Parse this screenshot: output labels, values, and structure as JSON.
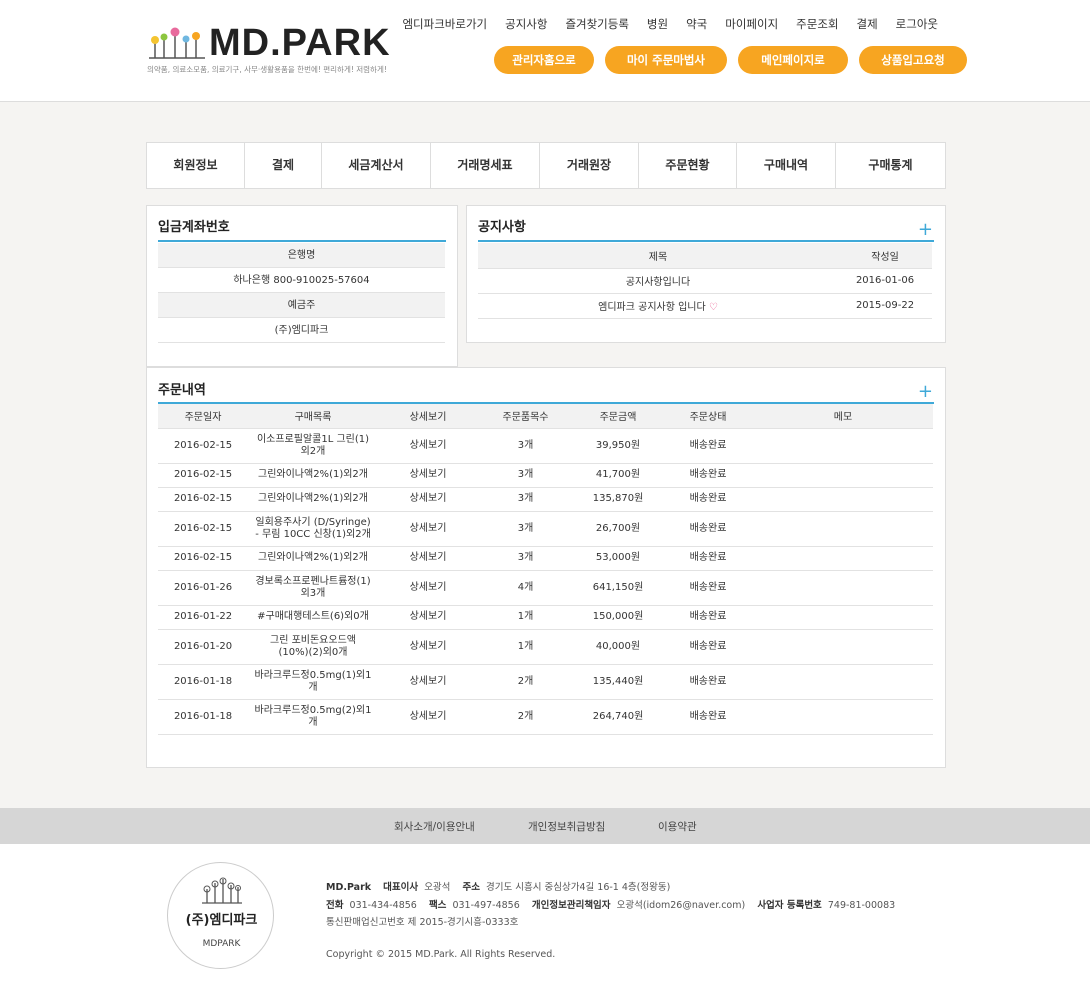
{
  "logo": {
    "text": "MD.PARK",
    "tagline": "의약품, 의료소모품, 의료기구, 사무·생활용품을 한번에! 편리하게! 저렴하게!"
  },
  "top_nav": [
    "엠디파크바로가기",
    "공지사항",
    "즐겨찾기등록",
    "병원",
    "약국",
    "마이페이지",
    "주문조회",
    "결제",
    "로그아웃"
  ],
  "orange_buttons": [
    "관리자홈으로",
    "마이 주문마법사",
    "메인페이지로",
    "상품입고요청"
  ],
  "tabs": [
    "회원정보",
    "결제",
    "세금계산서",
    "거래명세표",
    "거래원장",
    "주문현황",
    "구매내역",
    "구매통계"
  ],
  "deposit": {
    "title": "입금계좌번호",
    "bank_label": "은행명",
    "bank_value": "하나은행 800-910025-57604",
    "holder_label": "예금주",
    "holder_value": "(주)엠디파크"
  },
  "notice": {
    "title": "공지사항",
    "plus": "+",
    "headers": [
      "제목",
      "작성일"
    ],
    "rows": [
      {
        "title": "공지사항입니다",
        "date": "2016-01-06"
      },
      {
        "title": "엠디파크 공지사항 입니다",
        "date": "2015-09-22"
      }
    ]
  },
  "orders": {
    "title": "주문내역",
    "plus": "+",
    "headers": [
      "주문일자",
      "구매목록",
      "상세보기",
      "주문품목수",
      "주문금액",
      "주문상태",
      "메모"
    ],
    "rows": [
      {
        "date": "2016-02-15",
        "item": "이소프로필알콜1L 그린(1)\n외2개",
        "detail": "상세보기",
        "count": "3개",
        "amount": "39,950원",
        "status": "배송완료",
        "memo": ""
      },
      {
        "date": "2016-02-15",
        "item": "그린와이나액2%(1)외2개",
        "detail": "상세보기",
        "count": "3개",
        "amount": "41,700원",
        "status": "배송완료",
        "memo": ""
      },
      {
        "date": "2016-02-15",
        "item": "그린와이나액2%(1)외2개",
        "detail": "상세보기",
        "count": "3개",
        "amount": "135,870원",
        "status": "배송완료",
        "memo": ""
      },
      {
        "date": "2016-02-15",
        "item": "일회용주사기 (D/Syringe)\n- 무림 10CC 신창(1)외2개",
        "detail": "상세보기",
        "count": "3개",
        "amount": "26,700원",
        "status": "배송완료",
        "memo": ""
      },
      {
        "date": "2016-02-15",
        "item": "그린와이나액2%(1)외2개",
        "detail": "상세보기",
        "count": "3개",
        "amount": "53,000원",
        "status": "배송완료",
        "memo": ""
      },
      {
        "date": "2016-01-26",
        "item": "경보록소프로펜나트륨정(1)\n외3개",
        "detail": "상세보기",
        "count": "4개",
        "amount": "641,150원",
        "status": "배송완료",
        "memo": ""
      },
      {
        "date": "2016-01-22",
        "item": "#구매대행테스트(6)외0개",
        "detail": "상세보기",
        "count": "1개",
        "amount": "150,000원",
        "status": "배송완료",
        "memo": ""
      },
      {
        "date": "2016-01-20",
        "item": "그린 포비돈요오드액\n(10%)(2)외0개",
        "detail": "상세보기",
        "count": "1개",
        "amount": "40,000원",
        "status": "배송완료",
        "memo": ""
      },
      {
        "date": "2016-01-18",
        "item": "바라크루드정0.5mg(1)외1\n개",
        "detail": "상세보기",
        "count": "2개",
        "amount": "135,440원",
        "status": "배송완료",
        "memo": ""
      },
      {
        "date": "2016-01-18",
        "item": "바라크루드정0.5mg(2)외1\n개",
        "detail": "상세보기",
        "count": "2개",
        "amount": "264,740원",
        "status": "배송완료",
        "memo": ""
      }
    ]
  },
  "footer_links": [
    "회사소개/이용안내",
    "개인정보취급방침",
    "이용약관"
  ],
  "footer": {
    "logo_name": "(주)엠디파크",
    "logo_sub": "MDPARK",
    "company": "MD.Park",
    "ceo_label": "대표이사",
    "ceo": "오광석",
    "addr_label": "주소",
    "addr": "경기도 시흥시 중심상가4길 16-1 4층(정왕동)",
    "tel_label": "전화",
    "tel": "031-434-4856",
    "fax_label": "팩스",
    "fax": "031-497-4856",
    "privacy_label": "개인정보관리책임자",
    "privacy": "오광석(idom26@naver.com)",
    "biz_label": "사업자 등록번호",
    "biz": "749-81-00083",
    "mail_order": "통신판매업신고번호 제 2015-경기시흥-0333호",
    "copyright": "Copyright © 2015 MD.Park. All Rights Reserved."
  },
  "colors": {
    "accent_orange": "#f7a521",
    "accent_blue": "#3fa9d8",
    "heart": "#e8548a"
  }
}
